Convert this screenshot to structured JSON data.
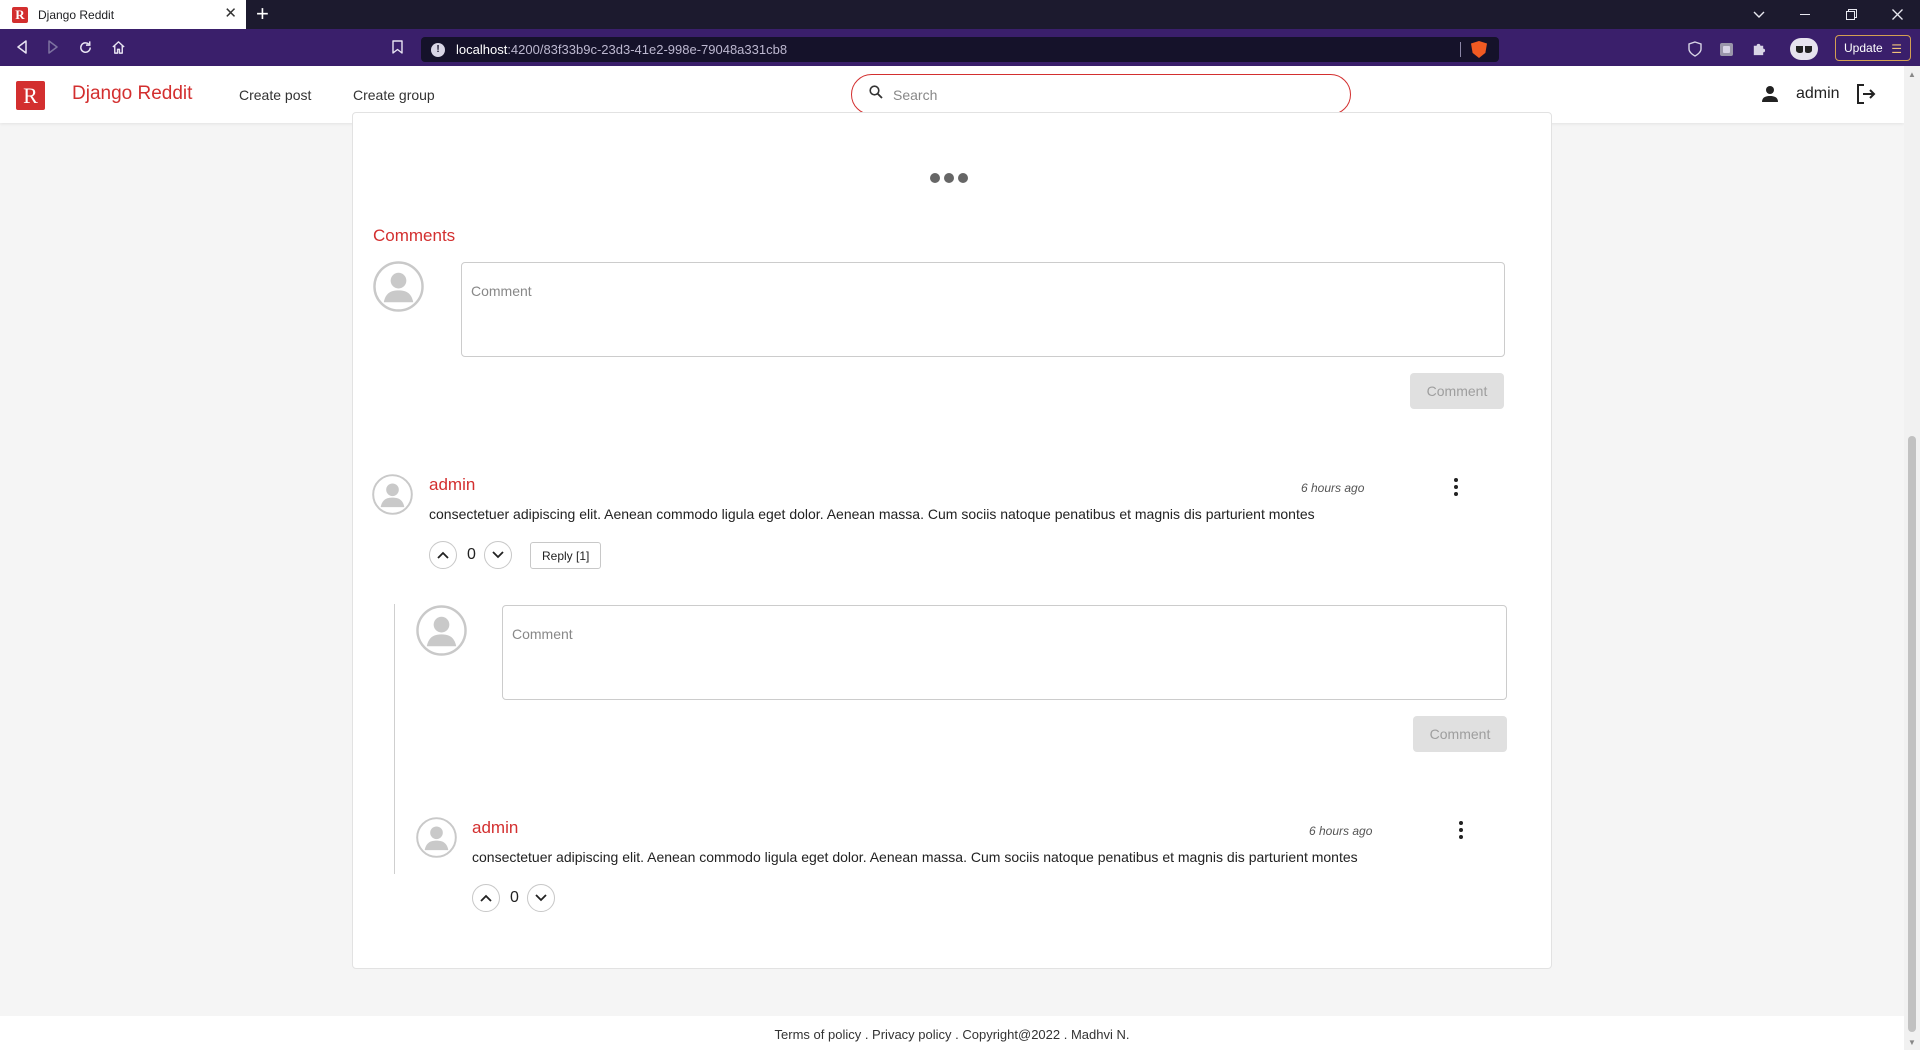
{
  "browser": {
    "tab_title": "Django Reddit",
    "tab_favicon": "R",
    "url_host": "localhost",
    "url_rest": ":4200/83f33b9c-23d3-41e2-998e-79048a331cb8",
    "update_label": "Update"
  },
  "header": {
    "logo_letter": "R",
    "brand": "Django Reddit",
    "nav": [
      "Create post",
      "Create group"
    ],
    "search_placeholder": "Search",
    "username": "admin",
    "accent_color": "#d32f2f"
  },
  "comments": {
    "title": "Comments",
    "new_comment_placeholder": "Comment",
    "submit_label": "Comment",
    "items": [
      {
        "author": "admin",
        "time": "6 hours ago",
        "text": "consectetuer adipiscing elit. Aenean commodo ligula eget dolor. Aenean massa. Cum sociis natoque penatibus et magnis dis parturient montes",
        "votes": "0",
        "reply_label": "Reply [1]",
        "reply_placeholder": "Comment",
        "reply_submit_label": "Comment",
        "replies": [
          {
            "author": "admin",
            "time": "6 hours ago",
            "text": "consectetuer adipiscing elit. Aenean commodo ligula eget dolor. Aenean massa. Cum sociis natoque penatibus et magnis dis parturient montes",
            "votes": "0"
          }
        ]
      }
    ]
  },
  "footer": {
    "text": "Terms of policy . Privacy policy . Copyright@2022 . Madhvi N."
  }
}
